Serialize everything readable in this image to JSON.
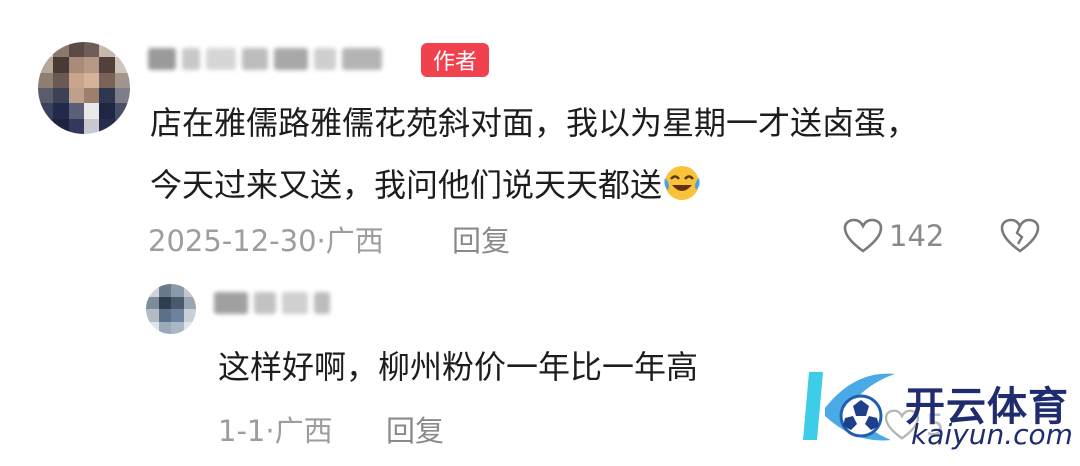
{
  "comment": {
    "author_badge": "作者",
    "text_line1": "店在雅儒路雅儒花苑斜对面，我以为星期一才送卤蛋，",
    "text_line2": "今天过来又送，我问他们说天天都送",
    "date": "2025-12-30",
    "location": "广西",
    "reply_label": "回复",
    "like_count": "142"
  },
  "reply": {
    "text": "这样好啊，柳州粉价一年比一年高",
    "date": "1-1",
    "location": "广西",
    "reply_label": "回复",
    "like_count": "5"
  },
  "watermark": {
    "brand": "开云体育",
    "url": "kaiyun.com"
  },
  "colors": {
    "badge": "#f1414f",
    "text": "#1d1d1d",
    "meta": "#9d9d9d",
    "watermark": "#1f2c6d"
  }
}
